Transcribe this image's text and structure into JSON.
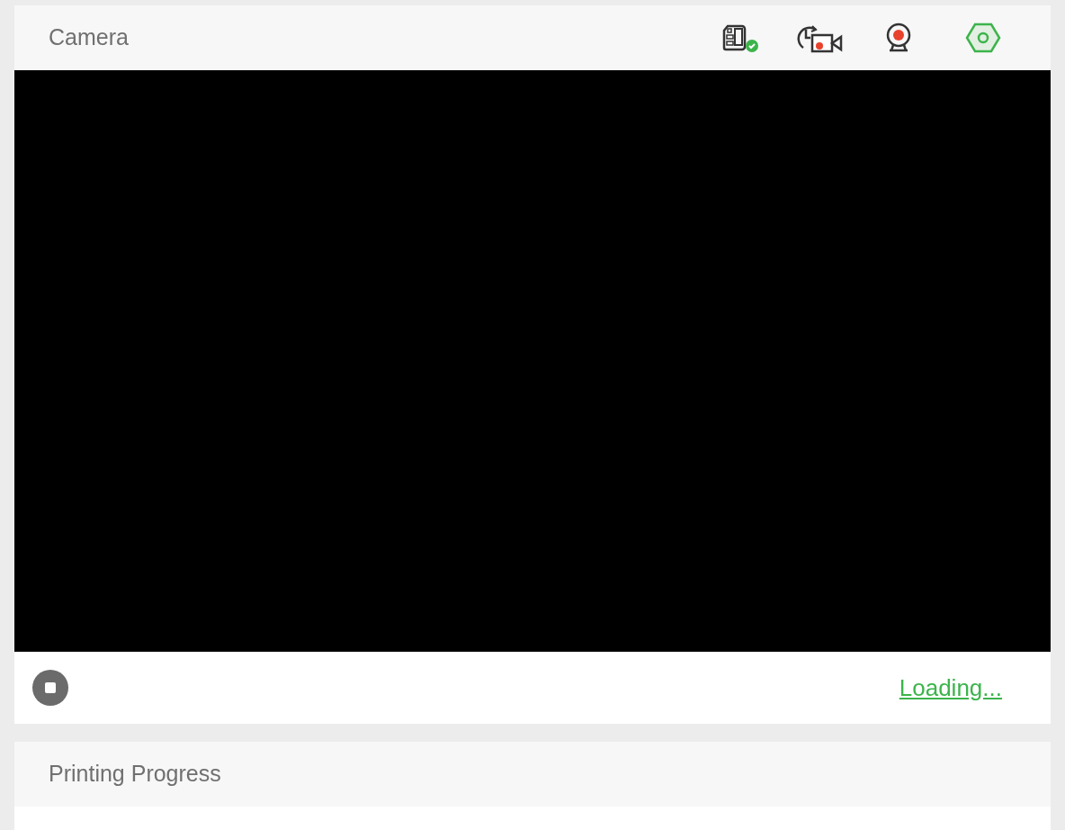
{
  "camera_panel": {
    "title": "Camera",
    "video": {
      "kind": "blank"
    },
    "status_link": "Loading..."
  },
  "progress_panel": {
    "title": "Printing Progress"
  }
}
